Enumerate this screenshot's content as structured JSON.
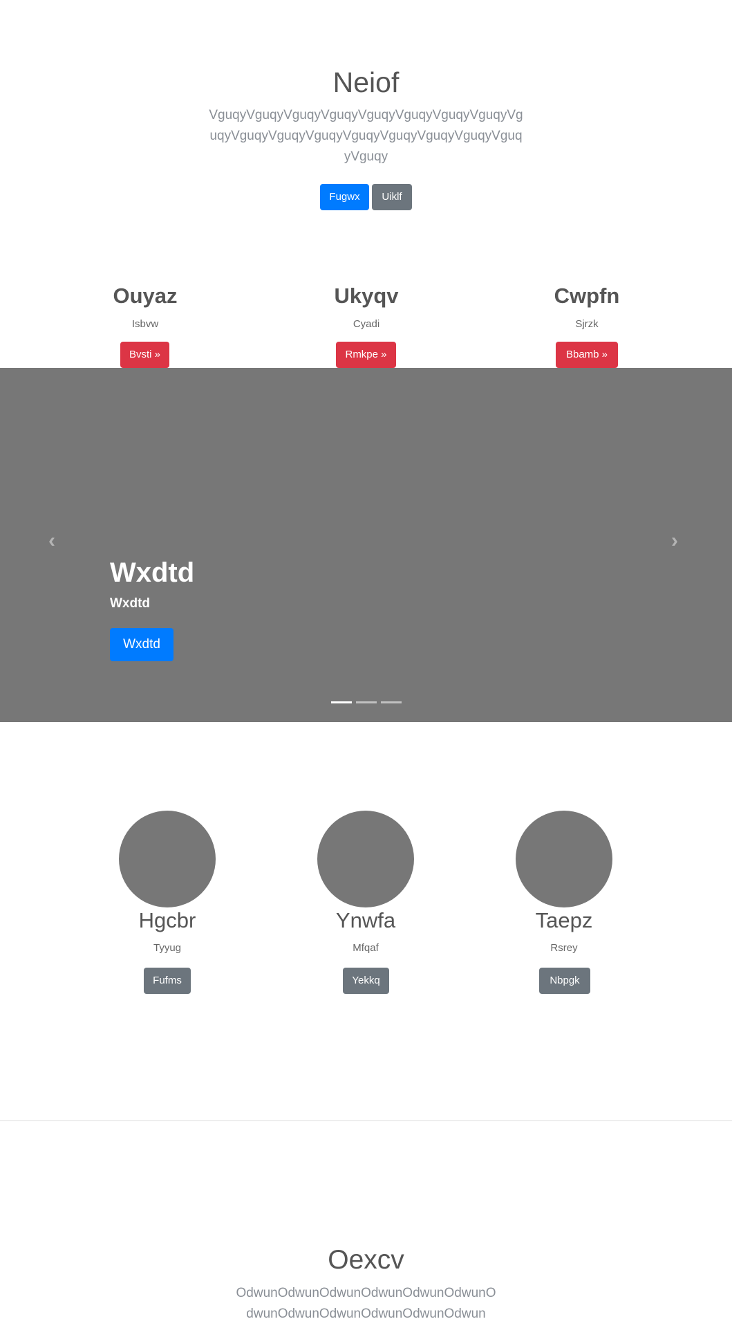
{
  "hero": {
    "title": "Neiof",
    "text": "VguqyVguqyVguqyVguqyVguqyVguqyVguqyVguqyVguqyVguqyVguqyVguqyVguqyVguqyVguqyVguqyVguqyVguqy",
    "primary_button": "Fugwx",
    "secondary_button": "Uiklf"
  },
  "features": [
    {
      "heading": "Ouyaz",
      "text": "Isbvw",
      "button": "Bvsti »"
    },
    {
      "heading": "Ukyqv",
      "text": "Cyadi",
      "button": "Rmkpe »"
    },
    {
      "heading": "Cwpfn",
      "text": "Sjrzk",
      "button": "Bbamb »"
    }
  ],
  "carousel": {
    "title": "Wxdtd",
    "subtitle": "Wxdtd",
    "button": "Wxdtd",
    "prev_icon": "chevron-left-icon",
    "next_icon": "chevron-right-icon",
    "prev_glyph": "‹",
    "next_glyph": "›",
    "slides_count": 3,
    "active_slide": 1
  },
  "team": [
    {
      "name": "Hgcbr",
      "role": "Tyyug",
      "button": "Fufms"
    },
    {
      "name": "Ynwfa",
      "role": "Mfqaf",
      "button": "Yekkq"
    },
    {
      "name": "Taepz",
      "role": "Rsrey",
      "button": "Nbpgk"
    }
  ],
  "footer": {
    "title": "Oexcv",
    "text": "OdwunOdwunOdwunOdwunOdwunOdwunOdwunOdwunOdwunOdwunOdwunOdwun"
  },
  "colors": {
    "primary": "#007bff",
    "secondary": "#6c757d",
    "danger": "#dc3545",
    "carousel_bg": "#777777",
    "placeholder_circle": "#777777"
  }
}
